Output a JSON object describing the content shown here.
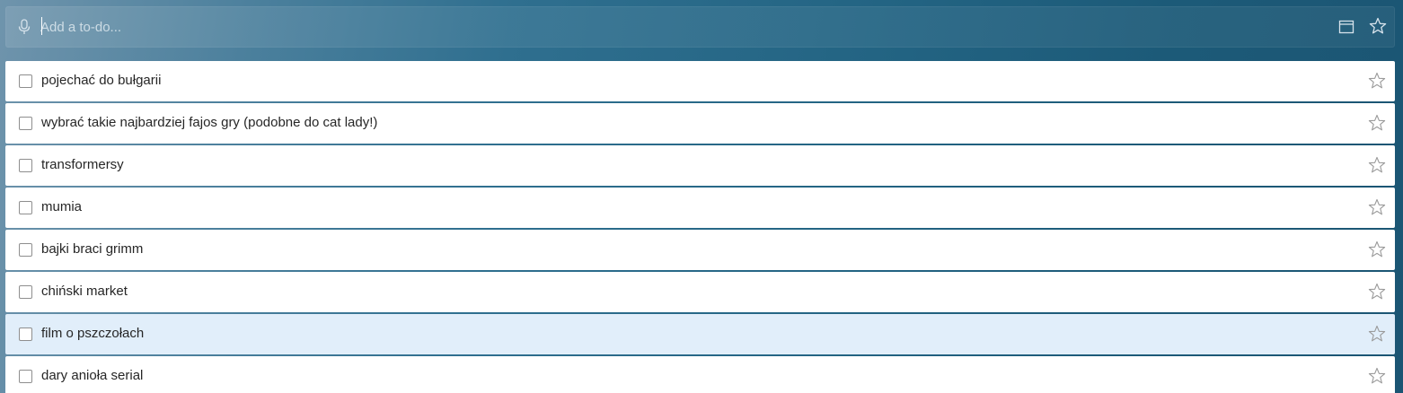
{
  "add_todo": {
    "placeholder": "Add a to-do...",
    "value": ""
  },
  "icons": {
    "mic": "microphone-icon",
    "layout": "layout-toggle-icon",
    "star": "star-icon",
    "checkbox": "checkbox"
  },
  "colors": {
    "accent": "#236483",
    "selected_row": "#e1eefa",
    "row_bg": "#ffffff"
  },
  "tasks": [
    {
      "label": "pojechać do bułgarii",
      "starred": false,
      "completed": false,
      "selected": false
    },
    {
      "label": "wybrać takie najbardziej fajos gry (podobne do cat lady!)",
      "starred": false,
      "completed": false,
      "selected": false
    },
    {
      "label": "transformersy",
      "starred": false,
      "completed": false,
      "selected": false
    },
    {
      "label": "mumia",
      "starred": false,
      "completed": false,
      "selected": false
    },
    {
      "label": "bajki braci grimm",
      "starred": false,
      "completed": false,
      "selected": false
    },
    {
      "label": "chiński market",
      "starred": false,
      "completed": false,
      "selected": false
    },
    {
      "label": "film o pszczołach",
      "starred": false,
      "completed": false,
      "selected": true
    },
    {
      "label": "dary anioła serial",
      "starred": false,
      "completed": false,
      "selected": false
    }
  ]
}
